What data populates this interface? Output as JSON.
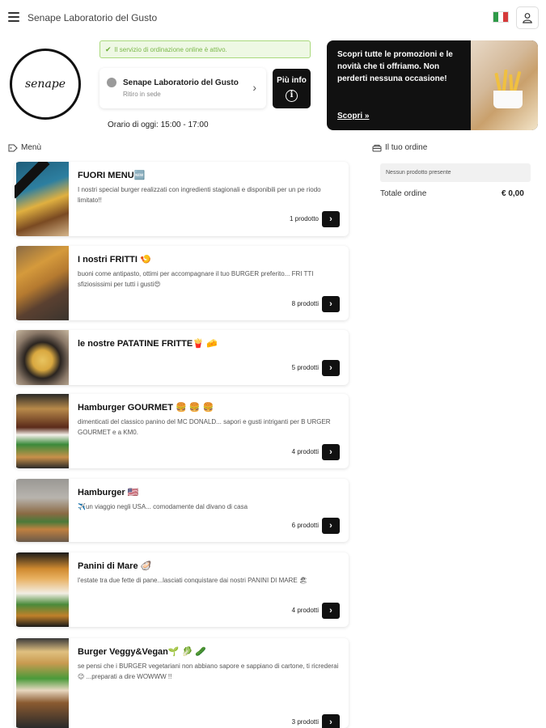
{
  "header": {
    "title": "Senape Laboratorio del Gusto",
    "menu_icon": "hamburger-menu-icon",
    "language_flag": "italian-flag-icon",
    "user_icon": "user-icon"
  },
  "logo": {
    "text": "senape"
  },
  "status": {
    "message": "Il servizio di ordinazione online è attivo."
  },
  "store": {
    "name": "Senape Laboratorio del Gusto",
    "mode": "Ritiro in sede"
  },
  "info_button": {
    "label": "Più info",
    "icon": "i"
  },
  "hours": "Orario di oggi: 15:00 - 17:00",
  "promo": {
    "text": "Scopri tutte le promozioni e le novità che ti offriamo. Non perderti nessuna occasione!",
    "cta": "Scopri »"
  },
  "sections": {
    "menu": "Menù",
    "order": "Il tuo ordine"
  },
  "order": {
    "empty": "Nessun prodotto presente",
    "total_label": "Totale ordine",
    "total_value": "€ 0,00"
  },
  "categories": [
    {
      "title": "FUORI MENU🆕",
      "desc": "I nostri special burger realizzati con ingredienti stagionali e disponibili per un pe riodo limitato!!",
      "count": "1 prodotto"
    },
    {
      "title": "I nostri FRITTI 🍤",
      "desc": "buoni come antipasto, ottimi per accompagnare il tuo BURGER preferito... FRI TTI sfiziosissimi per tutti i gusti😍",
      "count": "8 prodotti"
    },
    {
      "title": "le nostre PATATINE FRITTE🍟 🧀",
      "desc": "",
      "count": "5 prodotti"
    },
    {
      "title": "Hamburger GOURMET 🍔 🍔 🍔",
      "desc": "dimenticati del classico panino del MC DONALD... sapori e gusti intriganti per B URGER GOURMET e a KM0.",
      "count": "4 prodotti"
    },
    {
      "title": "Hamburger 🇺🇸",
      "desc": "✈️un viaggio negli USA... comodamente dal divano di casa",
      "count": "6 prodotti"
    },
    {
      "title": "Panini di Mare 🦪",
      "desc": "l'estate tra due fette di pane...lasciati conquistare dai nostri PANINI DI MARE 🏖",
      "count": "4 prodotti"
    },
    {
      "title": "Burger Veggy&Vegan🌱 🥬 🥒",
      "desc": "se pensi che i BURGER vegetariani non abbiano sapore e sappiano di cartone, ti ricrederai😉 ...preparati a dire WOWWW !!",
      "count": "3 prodotti"
    }
  ],
  "colors": {
    "accent": "#111111",
    "status_bg": "#eef8e4",
    "status_border": "#a9d97c",
    "status_text": "#7bb84a"
  }
}
